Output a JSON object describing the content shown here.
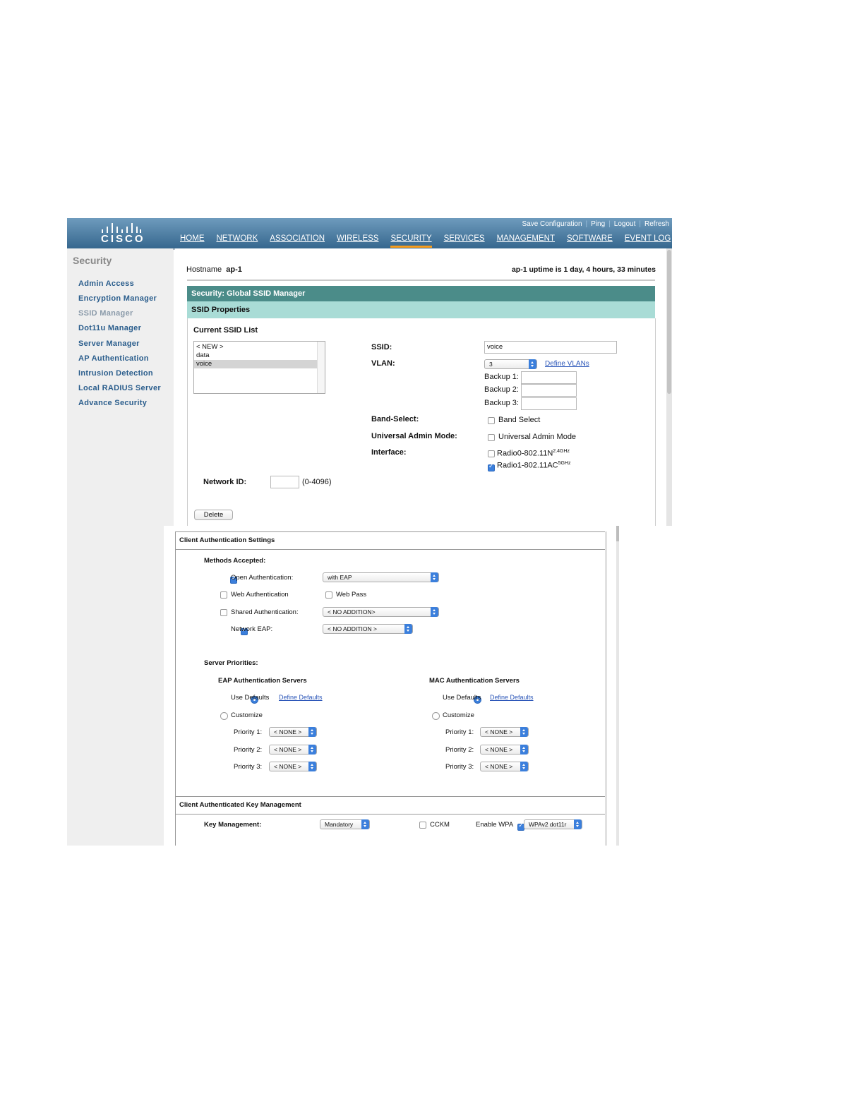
{
  "header": {
    "brand": "CISCO",
    "utility_links": [
      "Save Configuration",
      "Ping",
      "Logout",
      "Refresh"
    ],
    "nav": [
      "HOME",
      "NETWORK",
      "ASSOCIATION",
      "WIRELESS",
      "SECURITY",
      "SERVICES",
      "MANAGEMENT",
      "SOFTWARE",
      "EVENT LOG"
    ],
    "active_nav": "SECURITY",
    "accent_color": "#f79c1b"
  },
  "sidebar": {
    "title": "Security",
    "items": [
      "Admin Access",
      "Encryption Manager",
      "SSID Manager",
      "Dot11u Manager",
      "Server Manager",
      "AP Authentication",
      "Intrusion Detection",
      "Local RADIUS Server",
      "Advance Security"
    ],
    "current": "SSID Manager"
  },
  "status": {
    "hostname_label": "Hostname",
    "hostname": "ap-1",
    "uptime": "ap-1 uptime is 1 day, 4 hours, 33 minutes"
  },
  "page": {
    "title": "Security: Global SSID Manager",
    "section": "SSID Properties"
  },
  "ssid_list": {
    "label": "Current SSID List",
    "items": [
      "< NEW >",
      "data",
      "voice"
    ],
    "selected": "voice"
  },
  "ssid_form": {
    "ssid_label": "SSID:",
    "ssid_value": "voice",
    "vlan_label": "VLAN:",
    "vlan_value": "3",
    "define_vlans": "Define VLANs",
    "backup1": "Backup 1:",
    "backup2": "Backup 2:",
    "backup3": "Backup 3:",
    "band_select_label": "Band-Select:",
    "band_select_option": "Band Select",
    "band_select_checked": false,
    "universal_admin_label": "Universal Admin Mode:",
    "universal_admin_option": "Universal Admin Mode",
    "universal_admin_checked": false,
    "interface_label": "Interface:",
    "radio0": "Radio0-802.11N",
    "radio0_sup": "2.4GHz",
    "radio0_checked": false,
    "radio1": "Radio1-802.11AC",
    "radio1_sup": "5GHz",
    "radio1_checked": true,
    "network_id_label": "Network ID:",
    "network_id_range": "(0-4096)",
    "delete_button": "Delete"
  },
  "client_auth": {
    "title": "Client Authentication Settings",
    "methods_label": "Methods Accepted:",
    "open_auth": "Open Authentication:",
    "open_auth_checked": true,
    "open_auth_select": "with EAP",
    "web_auth": "Web Authentication",
    "web_auth_checked": false,
    "web_pass": "Web Pass",
    "web_pass_checked": false,
    "shared_auth": "Shared Authentication:",
    "shared_auth_checked": false,
    "shared_auth_select": "< NO ADDITION>",
    "network_eap": "Network EAP:",
    "network_eap_checked": true,
    "network_eap_select": "< NO ADDITION >",
    "server_priorities": "Server Priorities:",
    "eap_servers": {
      "title": "EAP Authentication Servers",
      "use_defaults": "Use Defaults",
      "define_defaults": "Define Defaults",
      "customize": "Customize",
      "priorities": [
        {
          "label": "Priority 1:",
          "value": "< NONE >"
        },
        {
          "label": "Priority 2:",
          "value": "< NONE >"
        },
        {
          "label": "Priority 3:",
          "value": "< NONE >"
        }
      ]
    },
    "mac_servers": {
      "title": "MAC Authentication Servers",
      "use_defaults": "Use Defaults",
      "define_defaults": "Define Defaults",
      "customize": "Customize",
      "priorities": [
        {
          "label": "Priority 1:",
          "value": "< NONE >"
        },
        {
          "label": "Priority 2:",
          "value": "< NONE >"
        },
        {
          "label": "Priority 3:",
          "value": "< NONE >"
        }
      ]
    }
  },
  "key_mgmt": {
    "title": "Client Authenticated Key Management",
    "label": "Key Management:",
    "select": "Mandatory",
    "cckm": "CCKM",
    "cckm_checked": false,
    "enable_wpa": "Enable WPA",
    "enable_wpa_checked": true,
    "wpa_select": "WPAv2 dot11r"
  }
}
